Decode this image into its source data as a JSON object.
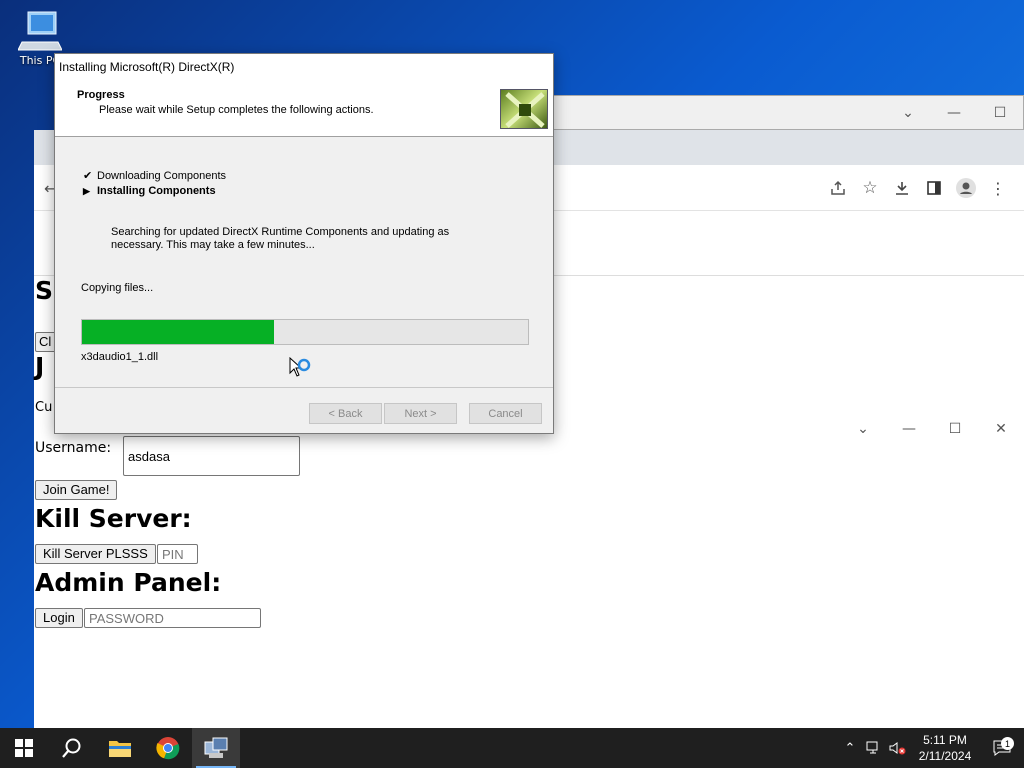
{
  "desktop": {
    "icon_label": "This PC"
  },
  "dialog": {
    "title": "Installing Microsoft(R) DirectX(R)",
    "header_title": "Progress",
    "header_subtitle": "Please wait while Setup completes the following actions.",
    "steps": [
      {
        "label": "Downloading Components",
        "status": "done"
      },
      {
        "label": "Installing Components",
        "status": "current"
      }
    ],
    "description": "Searching for updated DirectX Runtime Components and updating as necessary. This may take a few minutes...",
    "status_text": "Copying files...",
    "progress": 0.43,
    "current_file": "x3daudio1_1.dll",
    "back_label": "< Back",
    "next_label": "Next >",
    "cancel_label": "Cancel"
  },
  "page": {
    "heading_partial_1": "S",
    "button_partial": "Cl",
    "heading_partial_2": "J",
    "text_partial": "Cu",
    "username_label": "Username:",
    "username_value": "asdasa",
    "join_button": "Join Game!",
    "kill_heading": "Kill Server:",
    "kill_button": "Kill Server PLSSS",
    "pin_placeholder": "PIN",
    "admin_heading": "Admin Panel:",
    "login_button": "Login",
    "password_placeholder": "PASSWORD"
  },
  "taskbar": {
    "time": "5:11 PM",
    "date": "2/11/2024",
    "notification_count": "1"
  }
}
